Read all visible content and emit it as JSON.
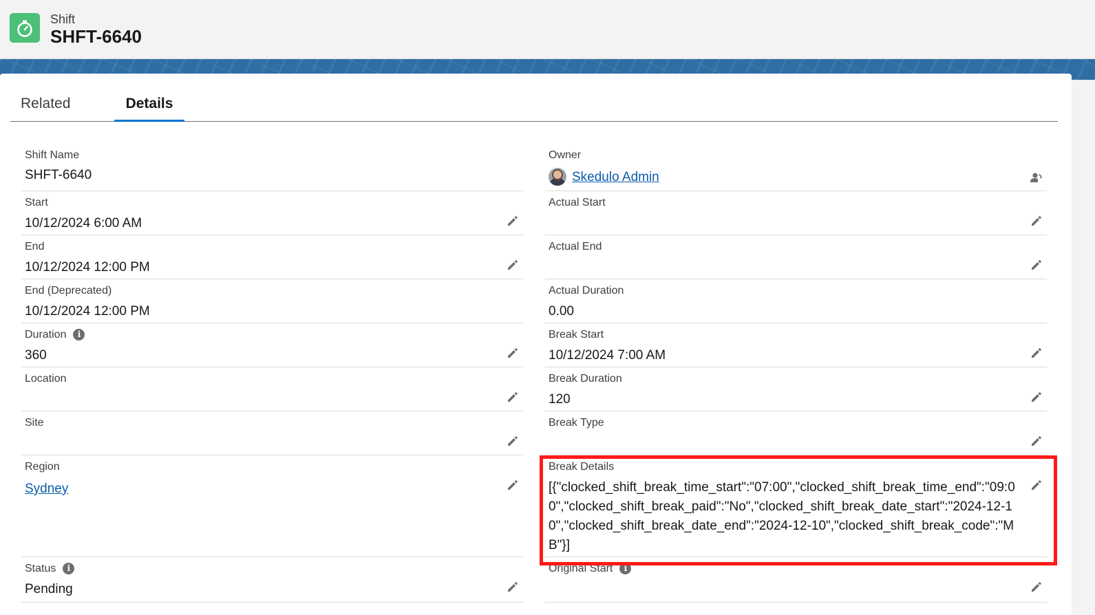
{
  "header": {
    "object_type": "Shift",
    "record_name": "SHFT-6640",
    "icon": "stopwatch-icon"
  },
  "tabs": [
    {
      "label": "Related",
      "active": false
    },
    {
      "label": "Details",
      "active": true
    }
  ],
  "left": {
    "shift_name": {
      "label": "Shift Name",
      "value": "SHFT-6640"
    },
    "start": {
      "label": "Start",
      "value": "10/12/2024 6:00 AM"
    },
    "end": {
      "label": "End",
      "value": "10/12/2024 12:00 PM"
    },
    "end_deprecated": {
      "label": "End (Deprecated)",
      "value": "10/12/2024 12:00 PM"
    },
    "duration": {
      "label": "Duration",
      "value": "360"
    },
    "location": {
      "label": "Location",
      "value": ""
    },
    "site": {
      "label": "Site",
      "value": ""
    },
    "region": {
      "label": "Region",
      "value": "Sydney"
    },
    "status": {
      "label": "Status",
      "value": "Pending"
    }
  },
  "right": {
    "owner": {
      "label": "Owner",
      "value": "Skedulo Admin"
    },
    "actual_start": {
      "label": "Actual Start",
      "value": ""
    },
    "actual_end": {
      "label": "Actual End",
      "value": ""
    },
    "actual_duration": {
      "label": "Actual Duration",
      "value": "0.00"
    },
    "break_start": {
      "label": "Break Start",
      "value": "10/12/2024 7:00 AM"
    },
    "break_duration": {
      "label": "Break Duration",
      "value": "120"
    },
    "break_type": {
      "label": "Break Type",
      "value": ""
    },
    "break_details": {
      "label": "Break Details",
      "value": "[{\"clocked_shift_break_time_start\":\"07:00\",\"clocked_shift_break_time_end\":\"09:00\",\"clocked_shift_break_paid\":\"No\",\"clocked_shift_break_date_start\":\"2024-12-10\",\"clocked_shift_break_date_end\":\"2024-12-10\",\"clocked_shift_break_code\":\"MB\"}]"
    },
    "original_start": {
      "label": "Original Start",
      "value": ""
    }
  },
  "info_glyph": "i",
  "colors": {
    "brand_blue": "#0176d3",
    "link": "#0b5cab",
    "app_icon_green": "#4bc076",
    "highlight_red": "#ff1a1a"
  }
}
